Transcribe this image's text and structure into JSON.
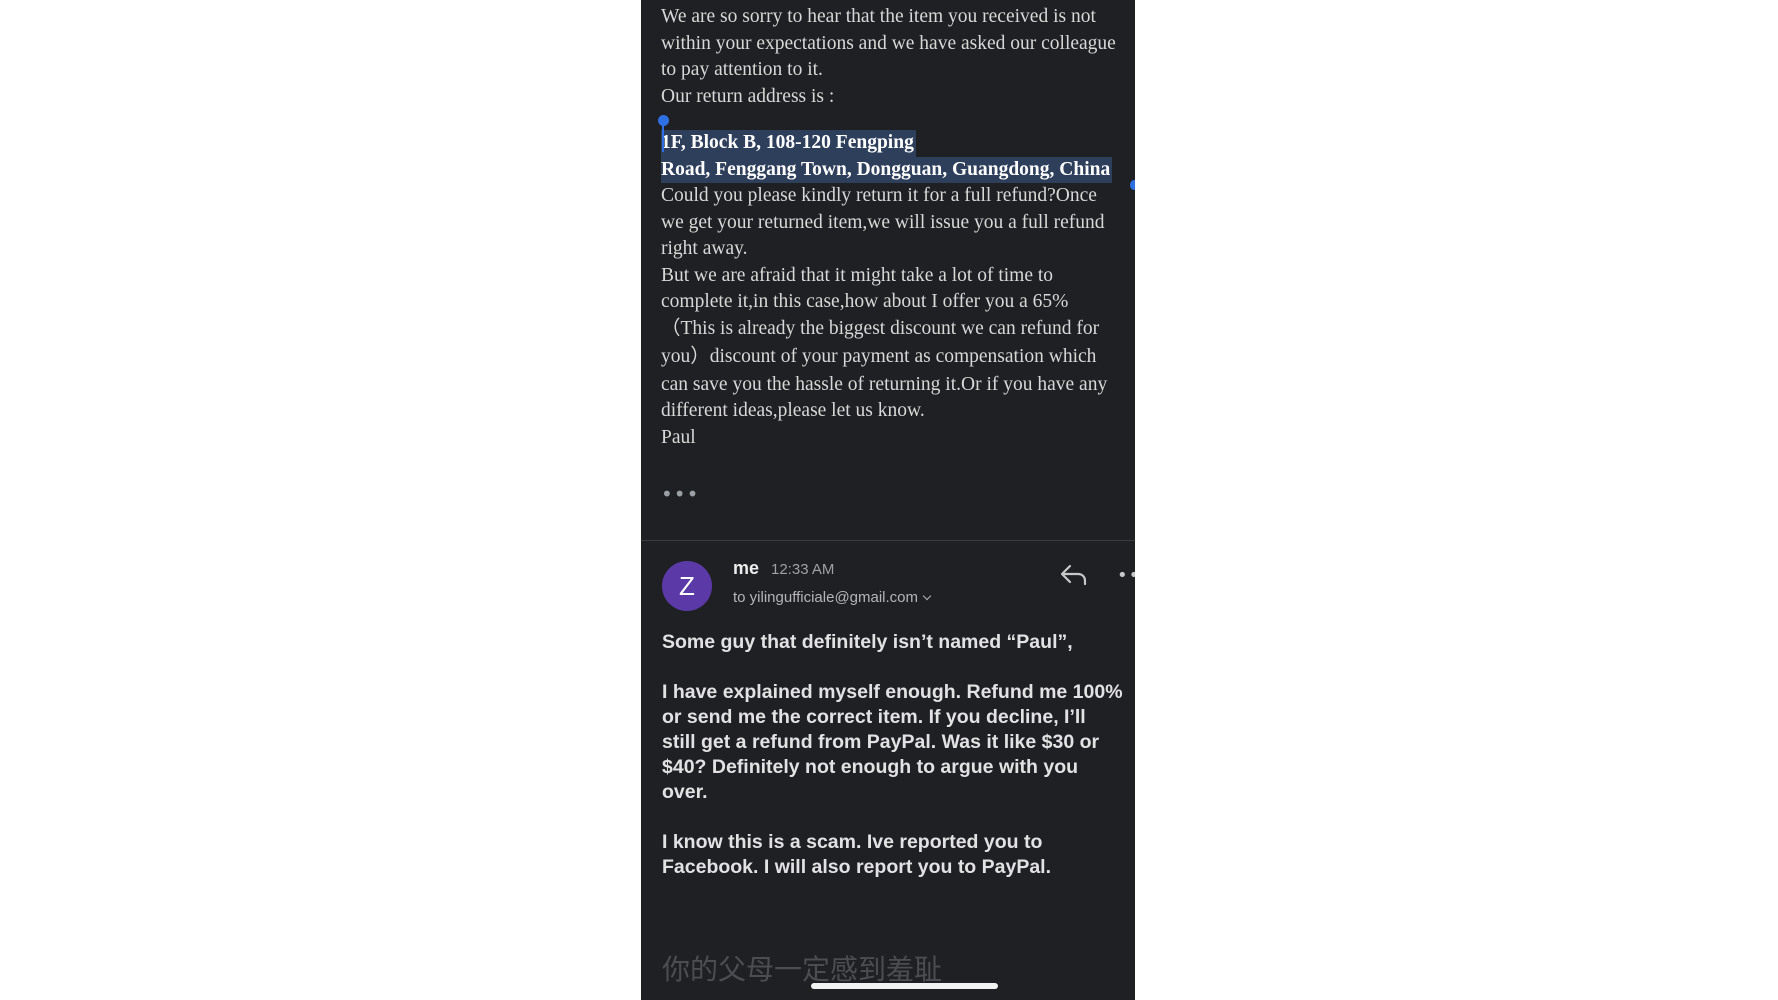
{
  "quoted_message": {
    "lines_before": [
      " We are so sorry to hear that the item you received is not",
      "within your expectations and we have asked our colleague",
      "to pay attention to it.",
      "Our return address is :"
    ],
    "address_lines": [
      "1F, Block B, 108-120 Fengping",
      "Road, Fenggang Town, Dongguan, Guangdong, China"
    ],
    "lines_after": [
      "Could you please kindly return it for a full refund?Once",
      "we get your returned item,we will issue you a full refund",
      "right away.",
      "But we are afraid that it might take a lot of time to",
      "complete it,in this case,how about I offer you a 65%",
      "（This is already the biggest discount we can refund for",
      "you）discount of your payment as compensation which",
      "can save you the hassle of returning it.Or if you have any",
      "different ideas,please let us know.",
      "Paul"
    ],
    "show_trimmed_label": "•••"
  },
  "reply": {
    "avatar_letter": "Z",
    "sender": "me",
    "time": "12:33 AM",
    "recipient": "to yilingufficiale@gmail.com",
    "more_label": "•••",
    "paragraph1": [
      "Some guy that definitely isn’t named “Paul”,"
    ],
    "paragraph2": [
      "I have explained myself enough. Refund me 100%",
      "or send me the correct item. If you decline, I’ll",
      "still get a refund from PayPal. Was it like $30 or",
      "$40? Definitely not enough to argue with you",
      "over."
    ],
    "paragraph3": [
      "I know this is a scam. Ive reported you to",
      "Facebook. I will also report you to PayPal."
    ]
  },
  "compose_text": "你的父母一定感到羞耻",
  "colors": {
    "background": "#1f2023",
    "selection": "#2e3f5c",
    "selection_handle": "#2f6fe4",
    "avatar": "#5b3aa8"
  }
}
